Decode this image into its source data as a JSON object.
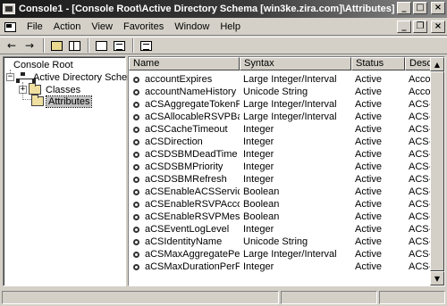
{
  "window": {
    "title": "Console1 - [Console Root\\Active Directory Schema [win3ke.zira.com]\\Attributes]",
    "controls": {
      "minimize": "_",
      "maximize": "□",
      "close": "×"
    }
  },
  "menubar": {
    "items": [
      {
        "label": "File"
      },
      {
        "label": "Action"
      },
      {
        "label": "View"
      },
      {
        "label": "Favorites"
      },
      {
        "label": "Window"
      },
      {
        "label": "Help"
      }
    ],
    "child_controls": {
      "minimize": "_",
      "restore": "❐",
      "close": "×"
    }
  },
  "toolbar": {
    "back_icon": "←",
    "forward_icon": "→"
  },
  "tree": {
    "root_label": "Console Root",
    "schema_label": "Active Directory Schema",
    "classes_label": "Classes",
    "attributes_label": "Attributes",
    "expander_open": "−",
    "expander_closed": "+"
  },
  "list": {
    "columns": [
      {
        "label": "Name"
      },
      {
        "label": "Syntax"
      },
      {
        "label": "Status"
      },
      {
        "label": "Desc"
      }
    ],
    "rows": [
      {
        "name": "accountExpires",
        "syntax": "Large Integer/Interval",
        "status": "Active",
        "desc": "Accou"
      },
      {
        "name": "accountNameHistory",
        "syntax": "Unicode String",
        "status": "Active",
        "desc": "Accou"
      },
      {
        "name": "aCSAggregateTokenRat...",
        "syntax": "Large Integer/Interval",
        "status": "Active",
        "desc": "ACS-A"
      },
      {
        "name": "aCSAllocableRSVPBand...",
        "syntax": "Large Integer/Interval",
        "status": "Active",
        "desc": "ACS-A"
      },
      {
        "name": "aCSCacheTimeout",
        "syntax": "Integer",
        "status": "Active",
        "desc": "ACS-C"
      },
      {
        "name": "aCSDirection",
        "syntax": "Integer",
        "status": "Active",
        "desc": "ACS-D"
      },
      {
        "name": "aCSDSBMDeadTime",
        "syntax": "Integer",
        "status": "Active",
        "desc": "ACS-D"
      },
      {
        "name": "aCSDSBMPriority",
        "syntax": "Integer",
        "status": "Active",
        "desc": "ACS-D"
      },
      {
        "name": "aCSDSBMRefresh",
        "syntax": "Integer",
        "status": "Active",
        "desc": "ACS-D"
      },
      {
        "name": "aCSEnableACSService",
        "syntax": "Boolean",
        "status": "Active",
        "desc": "ACS-E"
      },
      {
        "name": "aCSEnableRSVPAccount...",
        "syntax": "Boolean",
        "status": "Active",
        "desc": "ACS-E"
      },
      {
        "name": "aCSEnableRSVPMessag...",
        "syntax": "Boolean",
        "status": "Active",
        "desc": "ACS-E"
      },
      {
        "name": "aCSEventLogLevel",
        "syntax": "Integer",
        "status": "Active",
        "desc": "ACS-E"
      },
      {
        "name": "aCSIdentityName",
        "syntax": "Unicode String",
        "status": "Active",
        "desc": "ACS-I"
      },
      {
        "name": "aCSMaxAggregatePeak...",
        "syntax": "Large Integer/Interval",
        "status": "Active",
        "desc": "ACS-M"
      },
      {
        "name": "aCSMaxDurationPerFlow",
        "syntax": "Integer",
        "status": "Active",
        "desc": "ACS-M"
      }
    ],
    "scroll_up_icon": "▲",
    "scroll_down_icon": "▼"
  }
}
